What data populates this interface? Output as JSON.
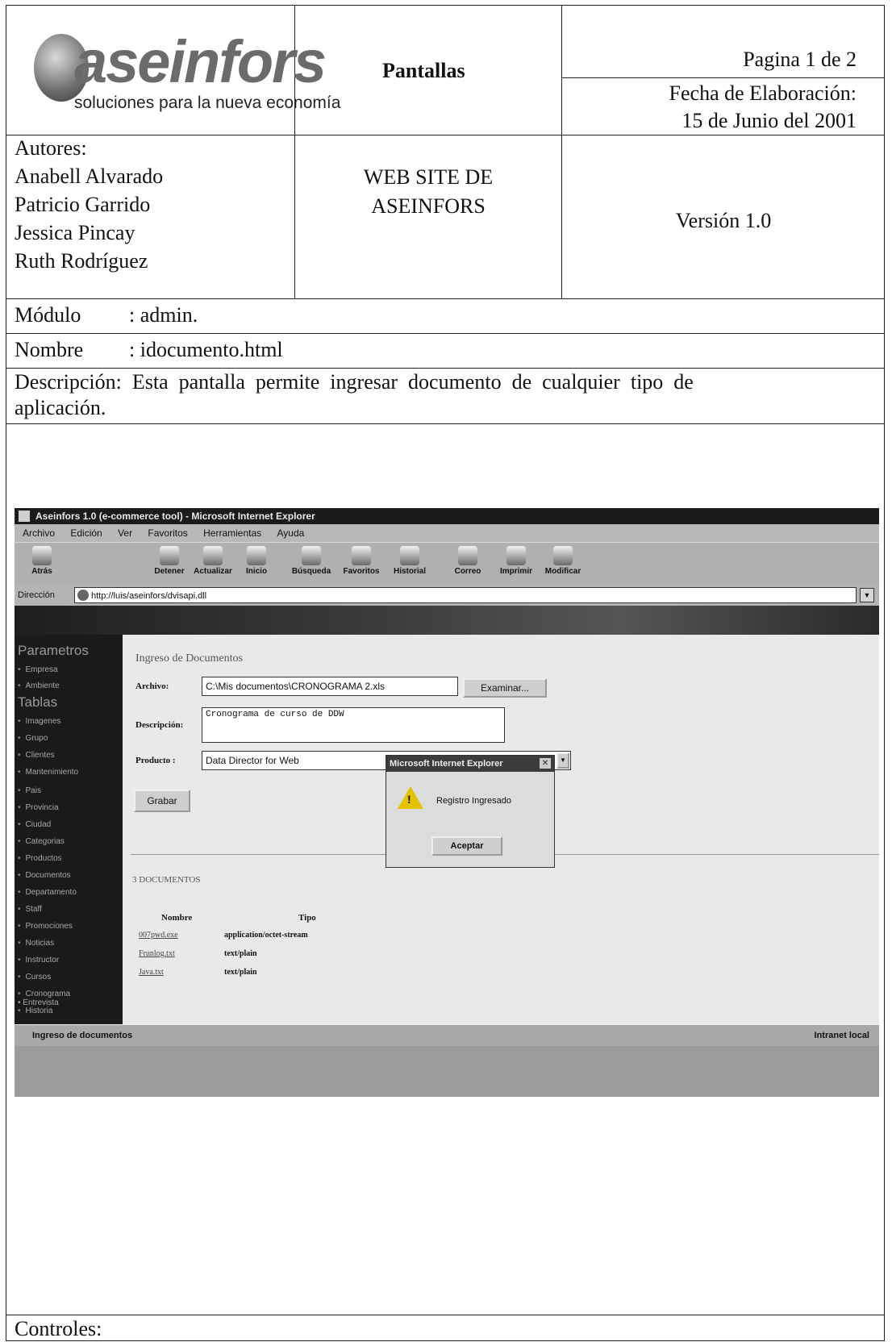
{
  "header": {
    "logo_text": "aseinfors",
    "logo_tagline": "soluciones para la nueva economía",
    "center_title": "Pantallas",
    "page_label": "Pagina 1 de 2",
    "date_label": "Fecha de Elaboración:",
    "date_value": "15 de Junio del 2001"
  },
  "info": {
    "authors_label": "Autores:",
    "authors": [
      "Anabell Alvarado",
      "Patricio Garrido",
      "Jessica Pincay",
      "Ruth Rodríguez"
    ],
    "project_line1": "WEB SITE DE",
    "project_line2": "ASEINFORS",
    "version": "Versión 1.0",
    "module_label": "Módulo",
    "module_value": ": admin.",
    "name_label": "Nombre",
    "name_value": ": idocumento.html",
    "description_line1": "Descripción:  Esta  pantalla  permite  ingresar  documento  de  cualquier  tipo  de",
    "description_line2": "aplicación.",
    "controls_label": "Controles:"
  },
  "browser": {
    "title": "Aseinfors 1.0 (e-commerce tool) - Microsoft Internet Explorer",
    "menu": [
      "Archivo",
      "Edición",
      "Ver",
      "Favoritos",
      "Herramientas",
      "Ayuda"
    ],
    "toolbar": [
      "Atrás",
      "Detener",
      "Actualizar",
      "Inicio",
      "Búsqueda",
      "Favoritos",
      "Historial",
      "Correo",
      "Imprimir",
      "Modificar"
    ],
    "address_label": "Dirección",
    "address_value": "http://luis/aseinfors/dvisapi.dll",
    "status_left": "Ingreso de documentos",
    "status_right": "Intranet local"
  },
  "sidebar": {
    "heading1": "Parametros",
    "group1": [
      "Empresa",
      "Ambiente"
    ],
    "heading2": "Tablas",
    "group2": [
      "Imagenes",
      "Grupo",
      "Clientes",
      "Mantenimiento",
      "Pais",
      "Provincia",
      "Ciudad",
      "Categorias",
      "Productos",
      "Documentos",
      "Departamento",
      "Staff",
      "Promociones",
      "Noticias",
      "Instructor",
      "Cursos",
      "Cronograma",
      "Historia",
      "Entrevista"
    ]
  },
  "form": {
    "title": "Ingreso de Documentos",
    "archivo_label": "Archivo:",
    "archivo_value": "C:\\Mis documentos\\CRONOGRAMA 2.xls",
    "examinar_button": "Examinar...",
    "descripcion_label": "Descripción:",
    "descripcion_value": "Cronograma de curso de DDW",
    "producto_label": "Producto :",
    "producto_value": "Data Director for Web",
    "grabar_button": "Grabar",
    "count_label": "3 DOCUMENTOS",
    "col_name": "Nombre",
    "col_type": "Tipo",
    "rows": [
      {
        "name": "007pwd.exe",
        "type": "application/octet-stream"
      },
      {
        "name": "Frunlog.txt",
        "type": "text/plain"
      },
      {
        "name": "Java.txt",
        "type": "text/plain"
      }
    ]
  },
  "dialog": {
    "title": "Microsoft Internet Explorer",
    "message": "Registro Ingresado",
    "ok_button": "Aceptar"
  }
}
